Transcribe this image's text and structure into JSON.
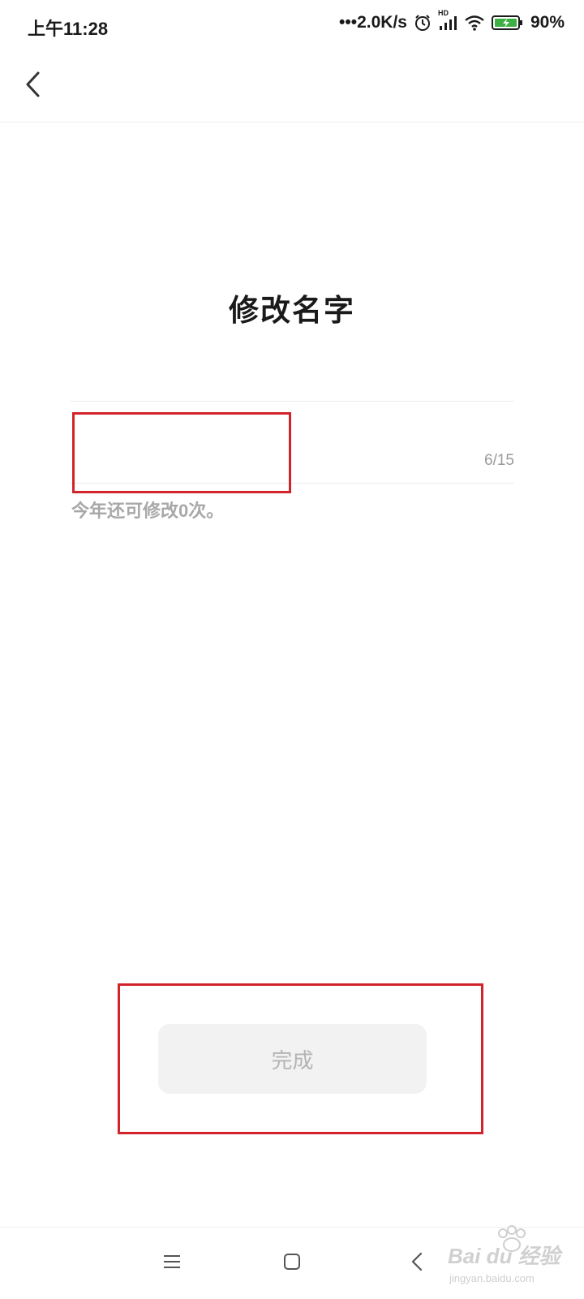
{
  "status_bar": {
    "time": "上午11:28",
    "network_speed": "•••2.0K/s",
    "network_badge": "HD",
    "battery_percent": "90%",
    "icons": [
      "alarm-icon",
      "signal-icon",
      "wifi-icon",
      "battery-icon"
    ]
  },
  "header": {
    "back_icon": "chevron-left-icon"
  },
  "page": {
    "title": "修改名字",
    "name_input": {
      "value": "",
      "placeholder": ""
    },
    "char_count": "6/15",
    "hint": "今年还可修改0次。",
    "done_button": "完成"
  },
  "nav_bar": {
    "icons": [
      "menu-icon",
      "home-icon",
      "back-icon"
    ]
  },
  "watermark": {
    "logo": "Bai du 经验",
    "url": "jingyan.baidu.com"
  },
  "colors": {
    "highlight": "#d2232a",
    "button_bg": "#f2f2f2",
    "button_text": "#b4b4b4",
    "hint_text": "#a8a8a8"
  }
}
